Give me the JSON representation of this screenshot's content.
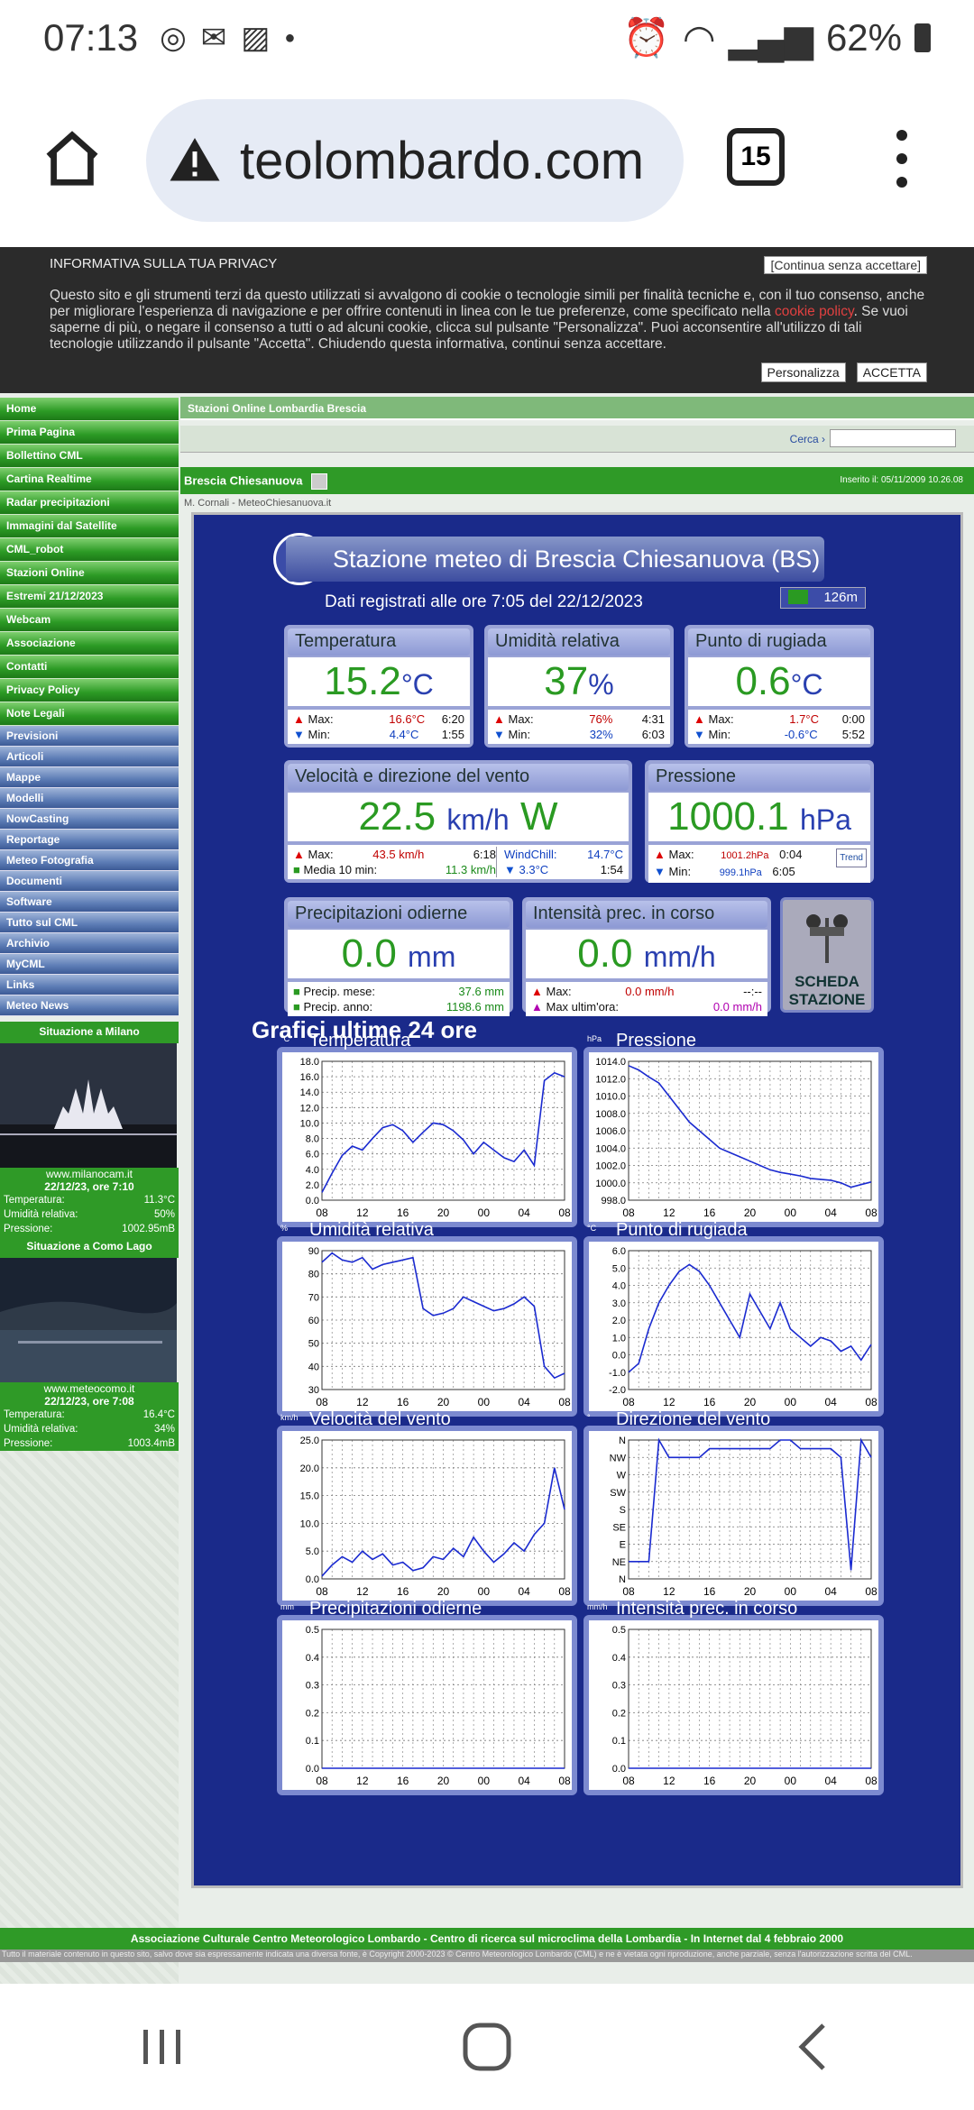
{
  "status_bar": {
    "time": "07:13",
    "battery": "62%"
  },
  "browser": {
    "url": "teolombardo.com",
    "tab_count": "15"
  },
  "privacy": {
    "title": "INFORMATIVA SULLA TUA PRIVACY",
    "continue": "[Continua senza accettare]",
    "text_before": "Questo sito e gli strumenti terzi da questo utilizzati si avvalgono di cookie o tecnologie simili per finalità tecniche e, con il tuo consenso, anche per migliorare l'esperienza di navigazione e per offrire contenuti in linea con le tue preferenze, come specificato nella ",
    "link": "cookie policy",
    "text_after": ". Se vuoi saperne di più, o negare il consenso a tutti o ad alcuni cookie, clicca sul pulsante \"Personalizza\". Puoi acconsentire all'utilizzo di tali tecnologie utilizzando il pulsante \"Accetta\". Chiudendo questa informativa, continui senza accettare.",
    "customize": "Personalizza",
    "accept": "ACCETTA"
  },
  "nav_green": [
    "Home",
    "Prima Pagina",
    "Bollettino CML",
    "Cartina Realtime",
    "Radar precipitazioni",
    "Immagini dal Satellite",
    "CML_robot",
    "Stazioni Online",
    "Estremi 21/12/2023",
    "Webcam",
    "Associazione",
    "Contatti",
    "Privacy Policy",
    "Note Legali"
  ],
  "nav_blue": [
    "Previsioni",
    "Articoli",
    "Mappe",
    "Modelli",
    "NowCasting",
    "Reportage",
    "Meteo Fotografia",
    "Documenti",
    "Software",
    "Tutto sul CML",
    "Archivio",
    "MyCML",
    "Links",
    "Meteo News"
  ],
  "milano": {
    "title": "Situazione a Milano",
    "site": "www.milanocam.it",
    "date": "22/12/23, ore 7:10",
    "temp_label": "Temperatura:",
    "temp": "11.3°C",
    "hum_label": "Umidità relativa:",
    "hum": "50%",
    "press_label": "Pressione:",
    "press": "1002.95mB"
  },
  "como": {
    "title": "Situazione a Como Lago",
    "site": "www.meteocomo.it",
    "date": "22/12/23, ore 7:08",
    "temp_label": "Temperatura:",
    "temp": "16.4°C",
    "hum_label": "Umidità relativa:",
    "hum": "34%",
    "press_label": "Pressione:",
    "press": "1003.4mB"
  },
  "breadcrumb": "Stazioni Online  Lombardia  Brescia",
  "search_label": "Cerca ›",
  "station_title": "Brescia Chiesanuova",
  "inserted": "Inserito il: 05/11/2009 10.26.08",
  "source": "M. Cornali - MeteoChiesanuova.it",
  "panel": {
    "title": "Stazione meteo di Brescia Chiesanuova (BS)",
    "subtitle": "Dati registrati alle ore 7:05 del 22/12/2023",
    "altitude": "126m",
    "logo": "CML"
  },
  "temp": {
    "label": "Temperatura",
    "value": "15.2",
    "unit": "°C",
    "max": "16.6°C",
    "max_t": "6:20",
    "min": "4.4°C",
    "min_t": "1:55"
  },
  "hum": {
    "label": "Umidità relativa",
    "value": "37",
    "unit": "%",
    "max": "76%",
    "max_t": "4:31",
    "min": "32%",
    "min_t": "6:03"
  },
  "dew": {
    "label": "Punto di rugiada",
    "value": "0.6",
    "unit": "°C",
    "max": "1.7°C",
    "max_t": "0:00",
    "min": "-0.6°C",
    "min_t": "5:52"
  },
  "wind": {
    "label": "Velocità e direzione del vento",
    "value": "22.5",
    "unit": "km/h",
    "dir": "W",
    "max": "43.5 km/h",
    "max_t": "6:18",
    "avg_label": "Media 10 min:",
    "avg": "11.3 km/h",
    "wc_label": "WindChill:",
    "wc": "14.7°C",
    "wc_min": "3.3°C",
    "wc_min_t": "1:54"
  },
  "press": {
    "label": "Pressione",
    "value": "1000.1",
    "unit": "hPa",
    "max": "1001.2hPa",
    "max_t": "0:04",
    "min": "999.1hPa",
    "min_t": "6:05",
    "trend": "Trend"
  },
  "rain": {
    "label": "Precipitazioni odierne",
    "value": "0.0",
    "unit": "mm",
    "month_label": "Precip. mese:",
    "month": "37.6 mm",
    "year_label": "Precip. anno:",
    "year": "1198.6 mm"
  },
  "rate": {
    "label": "Intensità prec. in corso",
    "value": "0.0",
    "unit": "mm/h",
    "max_label": "Max:",
    "max": "0.0 mm/h",
    "max_t": "--:--",
    "hour_label": "Max ultim'ora:",
    "hour": "0.0 mm/h"
  },
  "common": {
    "max": "Max:",
    "min": "Min:"
  },
  "scheda": "SCHEDA STAZIONE",
  "graphs_title": "Grafici ultime 24 ore",
  "graph_titles": [
    "Temperatura",
    "Pressione",
    "Umidità relativa",
    "Punto di rugiada",
    "Velocità del vento",
    "Direzione del vento",
    "Precipitazioni odierne",
    "Intensità prec. in corso"
  ],
  "graph_units": [
    "°C",
    "hPa",
    "%",
    "°C",
    "km/h",
    "°",
    "mm",
    "mm/h"
  ],
  "x_ticks": [
    "08",
    "12",
    "16",
    "20",
    "00",
    "04",
    "08"
  ],
  "chart_data": [
    {
      "type": "line",
      "title": "Temperatura",
      "ylabel": "°C",
      "ylim": [
        0,
        18
      ],
      "yticks": [
        "18.0",
        "16.0",
        "14.0",
        "12.0",
        "10.0",
        "8.0",
        "6.0",
        "4.0",
        "2.0",
        "0.0"
      ],
      "series": [
        {
          "values": [
            1.0,
            3.5,
            5.8,
            7.0,
            6.5,
            8.0,
            9.4,
            9.8,
            9.0,
            7.5,
            8.8,
            10.0,
            9.8,
            9.0,
            7.8,
            6.0,
            7.5,
            6.5,
            5.5,
            5.0,
            6.5,
            4.5,
            15.5,
            16.5,
            16.0
          ]
        }
      ]
    },
    {
      "type": "line",
      "title": "Pressione",
      "ylabel": "hPa",
      "ylim": [
        998,
        1014
      ],
      "yticks": [
        "1014.0",
        "1012.0",
        "1010.0",
        "1008.0",
        "1006.0",
        "1004.0",
        "1002.0",
        "1000.0",
        "998.0"
      ],
      "series": [
        {
          "values": [
            1013.5,
            1013.0,
            1012.2,
            1011.5,
            1010.0,
            1008.5,
            1007.0,
            1006.0,
            1005.0,
            1004.0,
            1003.5,
            1003.0,
            1002.5,
            1002.0,
            1001.5,
            1001.2,
            1001.0,
            1000.8,
            1000.5,
            1000.4,
            1000.3,
            1000.0,
            999.5,
            999.8,
            1000.1
          ]
        }
      ]
    },
    {
      "type": "line",
      "title": "Umidità relativa",
      "ylabel": "%",
      "ylim": [
        30,
        90
      ],
      "yticks": [
        "90",
        "80",
        "70",
        "60",
        "50",
        "40",
        "30"
      ],
      "series": [
        {
          "values": [
            85,
            89,
            86,
            85,
            87,
            82,
            84,
            85,
            86,
            87,
            65,
            62,
            63,
            65,
            70,
            68,
            66,
            64,
            65,
            67,
            70,
            66,
            40,
            35,
            37
          ]
        }
      ]
    },
    {
      "type": "line",
      "title": "Punto di rugiada",
      "ylabel": "°C",
      "ylim": [
        -2,
        6
      ],
      "yticks": [
        "6.0",
        "5.0",
        "4.0",
        "3.0",
        "2.0",
        "1.0",
        "0.0",
        "-1.0",
        "-2.0"
      ],
      "series": [
        {
          "values": [
            -1.0,
            -0.5,
            1.5,
            3.0,
            4.0,
            4.8,
            5.2,
            4.8,
            4.0,
            3.0,
            2.0,
            1.0,
            3.5,
            2.5,
            1.5,
            3.0,
            1.5,
            1.0,
            0.5,
            1.0,
            0.8,
            0.2,
            0.5,
            -0.3,
            0.6
          ]
        }
      ]
    },
    {
      "type": "line",
      "title": "Velocità del vento",
      "ylabel": "km/h",
      "ylim": [
        0,
        25
      ],
      "yticks": [
        "25.0",
        "20.0",
        "15.0",
        "10.0",
        "5.0",
        "0.0"
      ],
      "series": [
        {
          "values": [
            0.5,
            2.5,
            4.0,
            3.0,
            5.0,
            3.5,
            4.5,
            2.5,
            3.0,
            1.5,
            2.0,
            4.0,
            3.5,
            5.5,
            4.0,
            7.5,
            5.0,
            3.0,
            4.5,
            6.5,
            5.0,
            8.0,
            10.0,
            20.0,
            12.5
          ]
        }
      ]
    },
    {
      "type": "line",
      "title": "Direzione del vento",
      "ylabel": "°",
      "yticks": [
        "N",
        "NW",
        "W",
        "SW",
        "S",
        "SE",
        "E",
        "NE",
        "N"
      ],
      "series": [
        {
          "values": [
            1,
            1,
            1,
            8,
            7,
            7,
            7,
            7,
            7.5,
            7.5,
            7.5,
            7.5,
            7.5,
            7.5,
            7.5,
            8,
            8,
            7.5,
            7.5,
            7.5,
            7.5,
            7,
            0.5,
            8,
            7
          ]
        }
      ]
    },
    {
      "type": "line",
      "title": "Precipitazioni odierne",
      "ylabel": "mm",
      "ylim": [
        0,
        0.5
      ],
      "yticks": [
        "0.5",
        "0.4",
        "0.3",
        "0.2",
        "0.1",
        "0.0"
      ],
      "series": [
        {
          "values": [
            0,
            0,
            0,
            0,
            0,
            0,
            0,
            0,
            0,
            0,
            0,
            0,
            0,
            0,
            0,
            0,
            0,
            0,
            0,
            0,
            0,
            0,
            0,
            0,
            0
          ]
        }
      ]
    },
    {
      "type": "line",
      "title": "Intensità prec. in corso",
      "ylabel": "mm/h",
      "ylim": [
        0,
        0.5
      ],
      "yticks": [
        "0.5",
        "0.4",
        "0.3",
        "0.2",
        "0.1",
        "0.0"
      ],
      "series": [
        {
          "values": [
            0,
            0,
            0,
            0,
            0,
            0,
            0,
            0,
            0,
            0,
            0,
            0,
            0,
            0,
            0,
            0,
            0,
            0,
            0,
            0,
            0,
            0,
            0,
            0,
            0
          ]
        }
      ]
    }
  ],
  "footer": "Associazione Culturale Centro Meteorologico Lombardo - Centro di ricerca sul microclima della Lombardia - In Internet dal 4 febbraio 2000",
  "footer_small": "Tutto il materiale contenuto in questo sito, salvo dove sia espressamente indicata una diversa fonte, è Copyright 2000-2023 © Centro Meteorologico Lombardo (CML) e ne è vietata ogni riproduzione, anche parziale, senza l'autorizzazione scritta del CML."
}
